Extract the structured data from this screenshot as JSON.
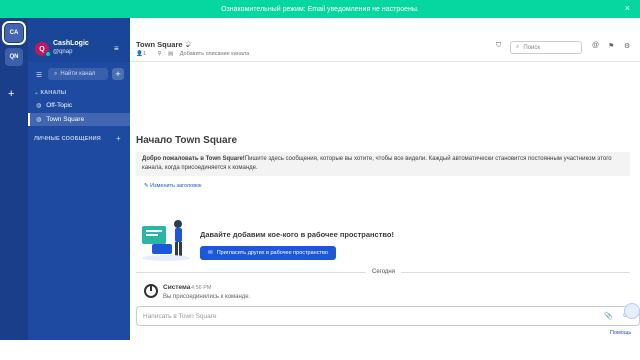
{
  "banner": {
    "text": "Ознакомительный режим: Email уведомления не настроены.",
    "close": "×"
  },
  "teams": {
    "items": [
      {
        "initials": "CA"
      },
      {
        "initials": "QN"
      }
    ],
    "add": "+"
  },
  "sidebar": {
    "team_name": "CashLogic",
    "avatar_letter": "Q",
    "username": "@qnap",
    "menu_icon": "≡",
    "find_placeholder": "Найти канал",
    "add_label": "+",
    "channels_section": "КАНАЛЫ",
    "channels": [
      {
        "label": "Off-Topic"
      },
      {
        "label": "Town Square"
      }
    ],
    "dm_section": "ЛИЧНЫЕ СООБЩЕНИЯ",
    "dm_add": "+"
  },
  "channel_header": {
    "title": "Town Square ⌄",
    "star": "☆",
    "member_count": "1",
    "add_description": "Добавить описание канала",
    "search_placeholder": "Поиск"
  },
  "intro": {
    "title": "Начало Town Square",
    "welcome_bold": "Добро пожаловать в Town Square!",
    "welcome_text": "Пишите здесь сообщения, которые вы хотите, чтобы все видели. Каждый автоматически становится постоянным участником этого канала, когда присоединяется к команде.",
    "edit_header": "Изменить заголовок"
  },
  "invite": {
    "title": "Давайте добавим кое-кого в рабочее пространство!",
    "button": "Пригласить других в рабочее пространство"
  },
  "timeline": {
    "date_label": "Сегодня",
    "author": "Система",
    "time": "4:56 PM",
    "message": "Вы присоединились к команде."
  },
  "composer": {
    "placeholder": "Написать в Town Square"
  },
  "footer": {
    "help": "Помощь"
  },
  "colors": {
    "accent": "#1c58d9",
    "banner": "#06d6a0",
    "sidebar": "#1e4ba1",
    "team_bar": "#1b3e8a"
  }
}
